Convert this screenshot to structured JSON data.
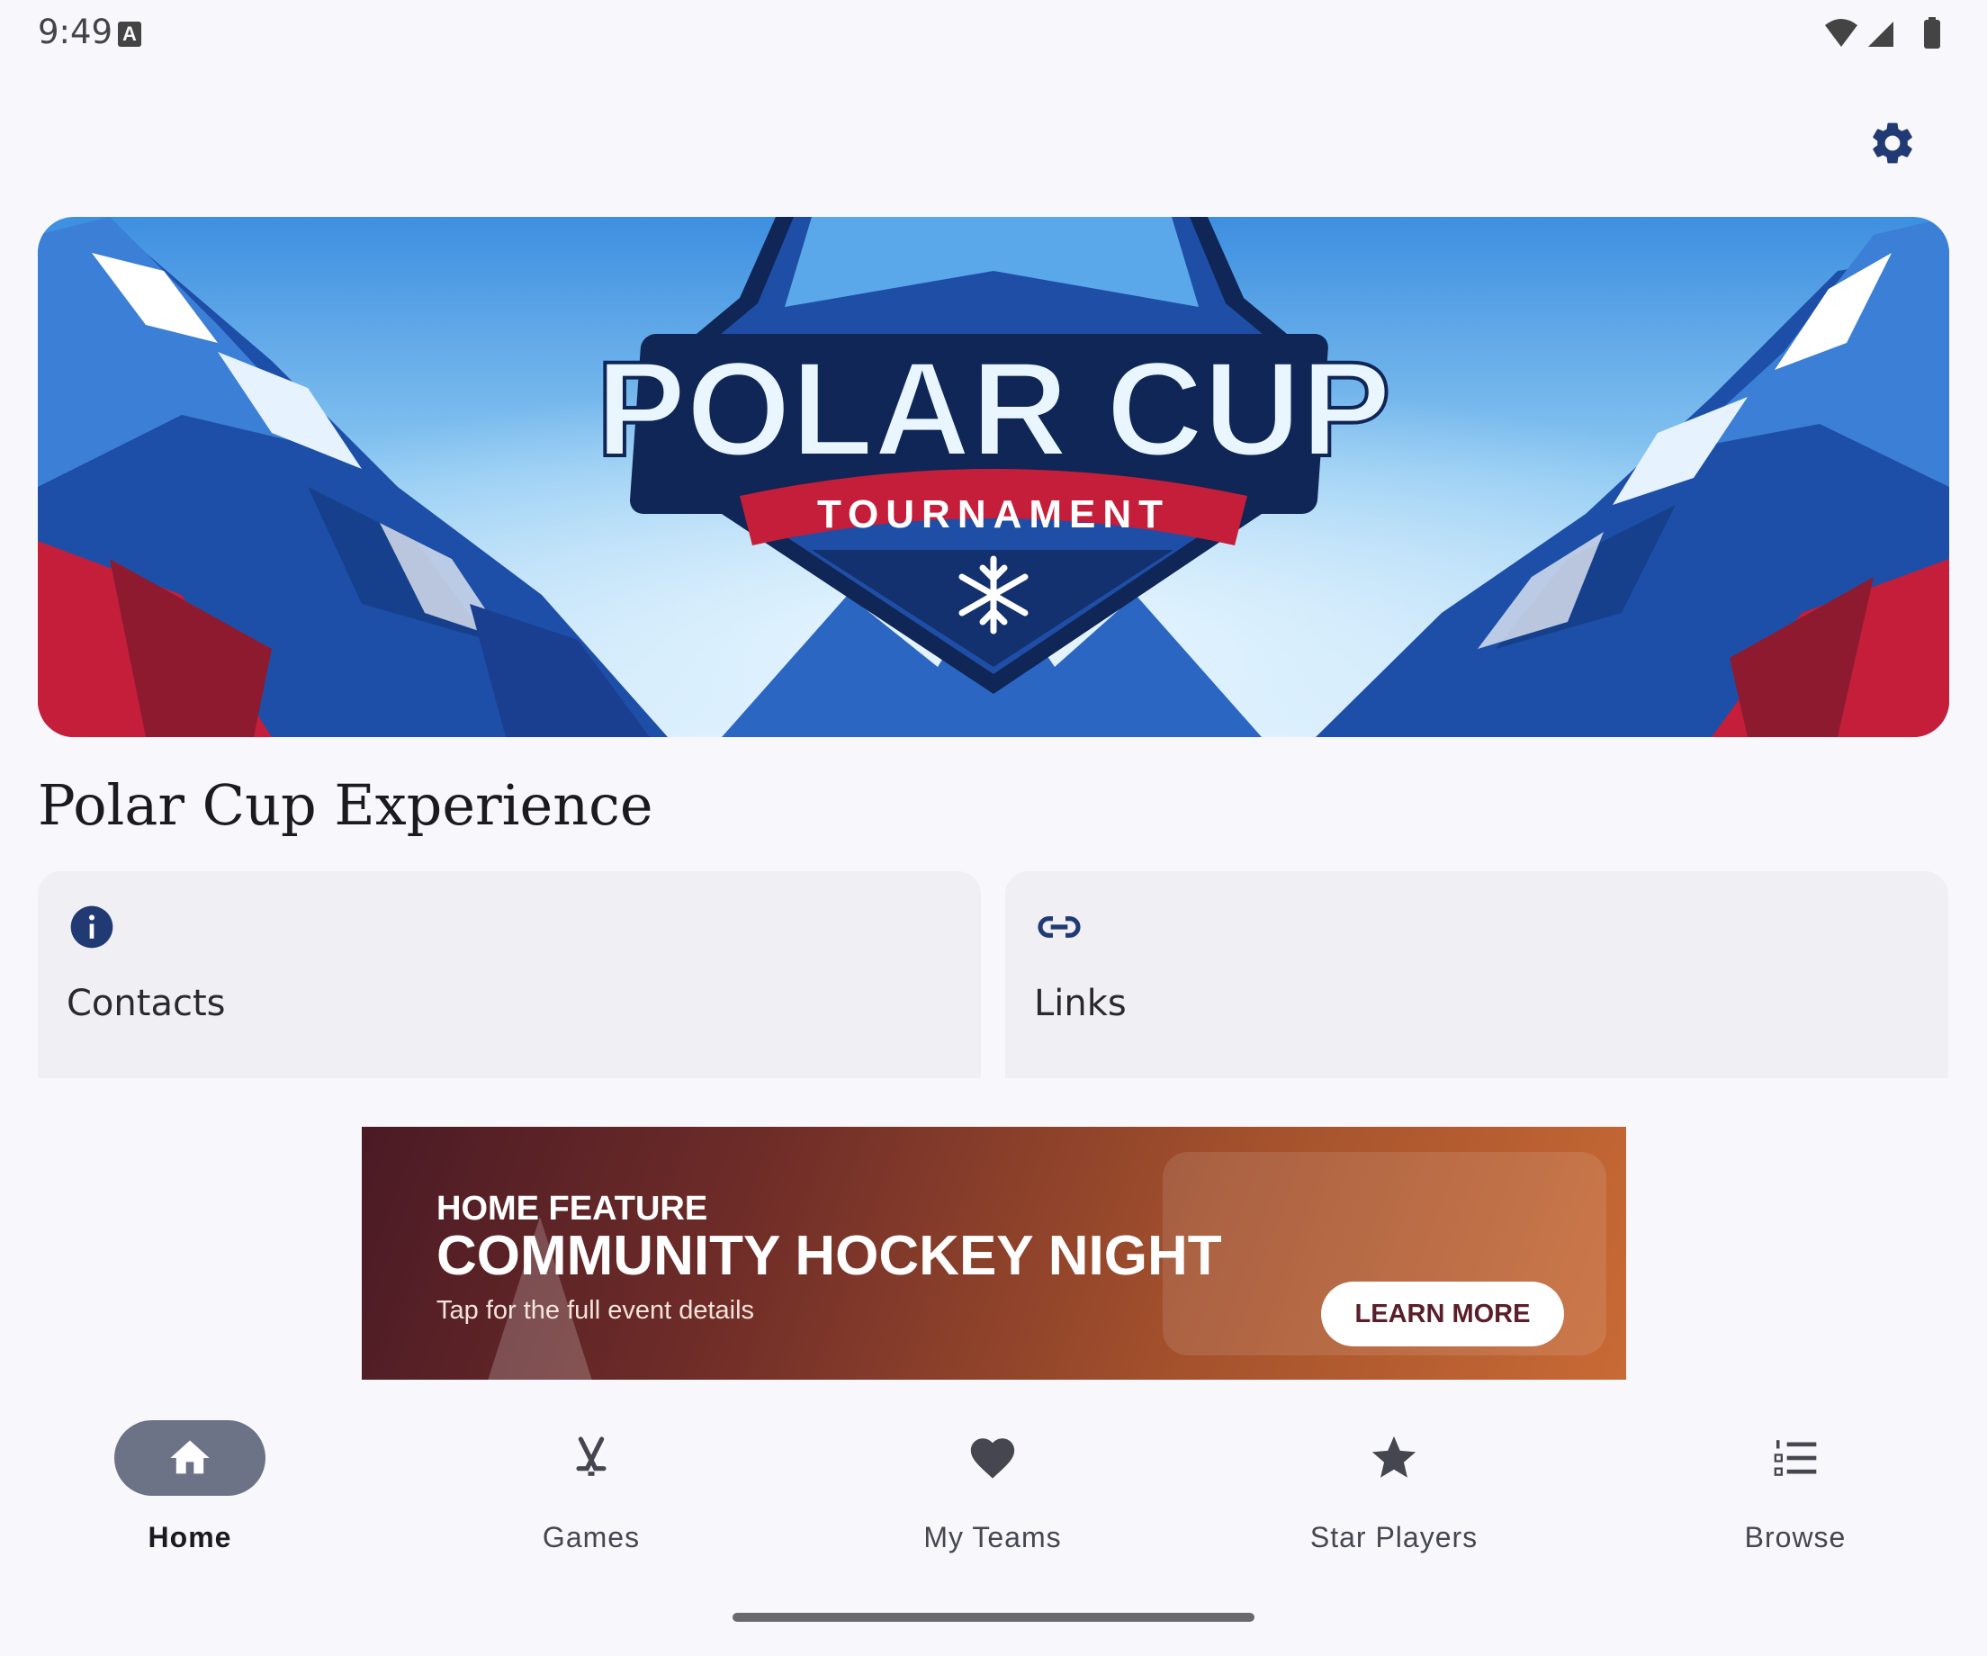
{
  "status_bar": {
    "time": "9:49",
    "notification_icon": "a-icon",
    "indicators": [
      "wifi-icon",
      "signal-icon",
      "battery-icon"
    ]
  },
  "header": {
    "settings_icon": "gear-icon"
  },
  "banner": {
    "logo_title": "POLAR CUP",
    "logo_subtitle": "TOURNAMENT",
    "logo_icon": "snowflake-icon"
  },
  "section": {
    "title": "Polar Cup Experience"
  },
  "cards": [
    {
      "label": "Contacts",
      "icon": "info-icon"
    },
    {
      "label": "Links",
      "icon": "link-icon"
    }
  ],
  "promo": {
    "kicker": "HOME FEATURE",
    "title": "COMMUNITY HOCKEY NIGHT",
    "subtitle": "Tap for the full event details",
    "button_label": "LEARN MORE"
  },
  "nav": {
    "items": [
      {
        "label": "Home",
        "icon": "home-icon",
        "active": true
      },
      {
        "label": "Games",
        "icon": "hockey-sticks-icon",
        "active": false
      },
      {
        "label": "My Teams",
        "icon": "heart-icon",
        "active": false
      },
      {
        "label": "Star Players",
        "icon": "star-icon",
        "active": false
      },
      {
        "label": "Browse",
        "icon": "numbered-list-icon",
        "active": false
      }
    ]
  },
  "colors": {
    "accent": "#213a73",
    "nav_active_pill": "#6d7387",
    "card_bg": "#efeff4",
    "page_bg": "#f8f8fc",
    "promo_start": "#4a1a25",
    "promo_end": "#c86a35"
  }
}
